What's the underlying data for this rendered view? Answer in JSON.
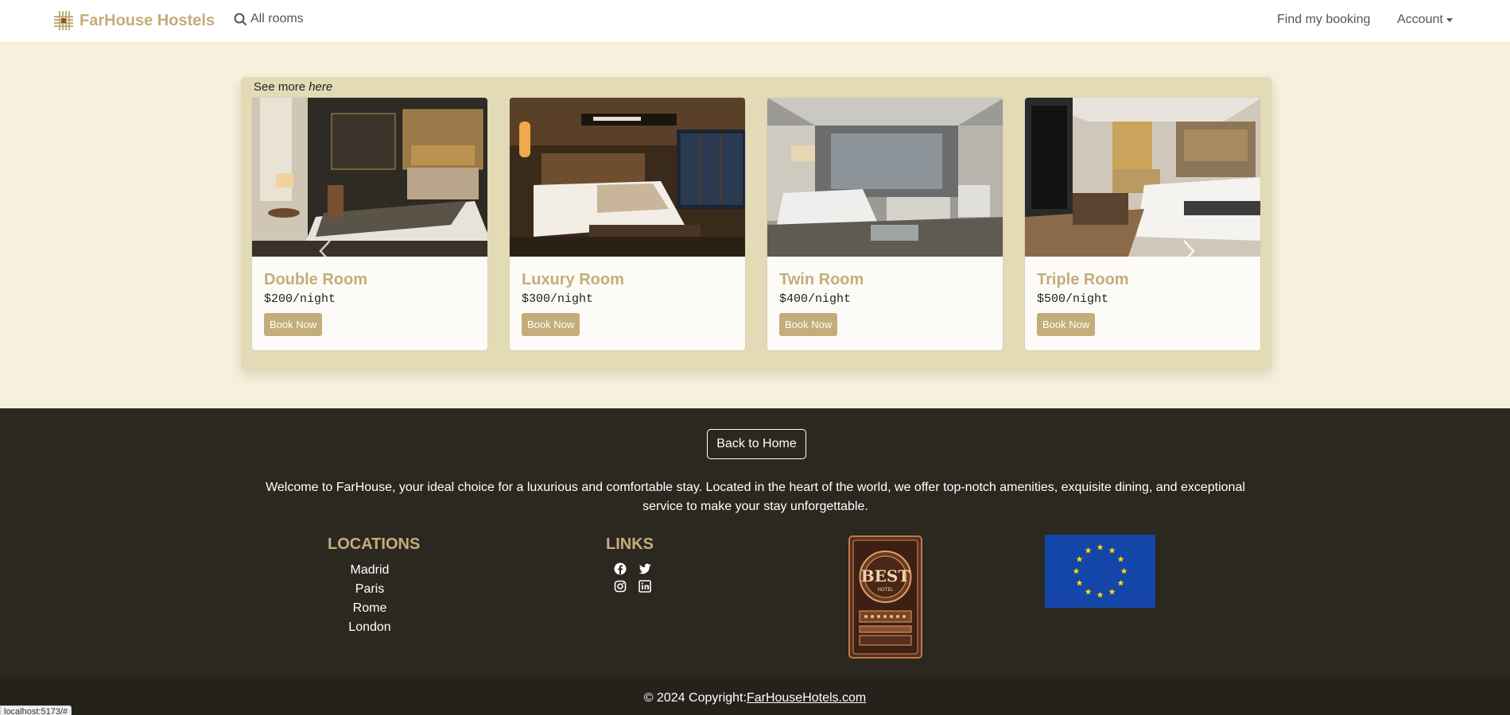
{
  "navbar": {
    "brand": "FarHouse Hostels",
    "all_rooms": "All rooms",
    "find_booking": "Find my booking",
    "account": "Account"
  },
  "carousel": {
    "see_more_prefix": "See more ",
    "see_more_link": "here",
    "rooms": [
      {
        "title": "Double Room",
        "price": "$200/night",
        "button": "Book Now"
      },
      {
        "title": "Luxury Room",
        "price": "$300/night",
        "button": "Book Now"
      },
      {
        "title": "Twin Room",
        "price": "$400/night",
        "button": "Book Now"
      },
      {
        "title": "Triple Room",
        "price": "$500/night",
        "button": "Book Now"
      }
    ]
  },
  "footer": {
    "back_button": "Back to Home",
    "about": "Welcome to FarHouse, your ideal choice for a luxurious and comfortable stay. Located in the heart of the world, we offer top-notch amenities, exquisite dining, and exceptional service to make your stay unforgettable.",
    "locations_title": "LOCATIONS",
    "locations": [
      "Madrid",
      "Paris",
      "Rome",
      "London"
    ],
    "links_title": "LINKS",
    "social_icons": [
      "facebook-icon",
      "twitter-icon",
      "instagram-icon",
      "linkedin-icon"
    ],
    "badge_text": "BEST",
    "badge_sub": "HOTEL",
    "copyright_prefix": "© 2024 Copyright:",
    "copyright_link": "FarHouseHotels.com"
  },
  "status_bar_url": "localhost:5173/#",
  "colors": {
    "accent": "#c4ad7a",
    "page_bg": "#f7f0dc",
    "carousel_bg": "#e3dab6",
    "footer_bg": "#2b2820",
    "copyright_bg": "#25221b"
  }
}
